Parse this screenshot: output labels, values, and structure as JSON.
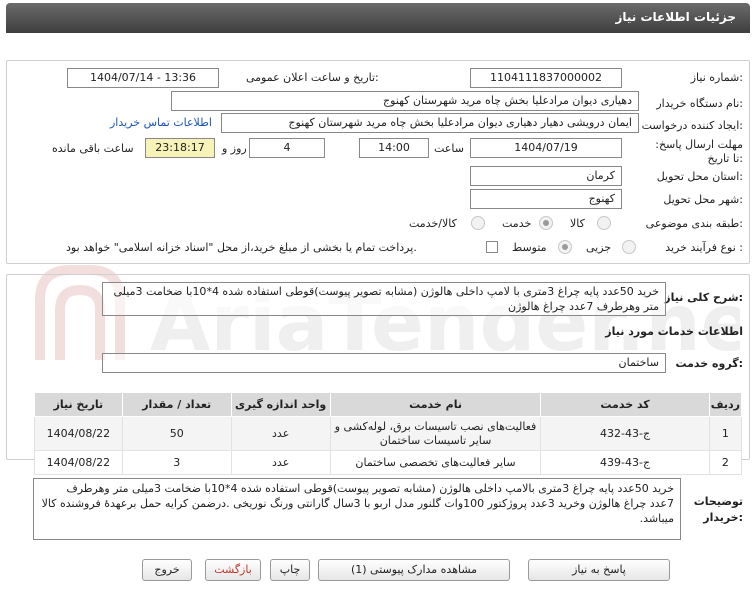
{
  "header": {
    "title": "جزئیات اطلاعات نیاز"
  },
  "need": {
    "number_label": "شماره نیاز:",
    "number_value": "1104111837000002",
    "announce_label": "تاریخ و ساعت اعلان عمومی:",
    "announce_value": "1404/07/14 - 13:36",
    "buyer_org_label": "نام دستگاه خریدار:",
    "buyer_org_value": "دهیاری دیوان مرادعلیا بخش چاه مرید شهرستان کهنوج",
    "creator_label": "ایجاد کننده درخواست:",
    "creator_value": "ایمان درویشی دهیار دهیاری دیوان مرادعلیا بخش چاه مرید شهرستان کهنوج",
    "contact_link": "اطلاعات تماس خریدار",
    "deadline_label": "مهلت ارسال پاسخ: تا تاریخ:",
    "deadline_date": "1404/07/19",
    "time_label": "ساعت",
    "deadline_time": "14:00",
    "days_value": "4",
    "days_label": "روز و",
    "remaining_time": "23:18:17",
    "remaining_label": "ساعت باقی مانده",
    "province_label": "استان محل تحویل:",
    "province_value": "کرمان",
    "city_label": "شهر محل تحویل:",
    "city_value": "کهنوج",
    "category_label": "طبقه بندی موضوعی:",
    "category_options": [
      "کالا",
      "خدمت",
      "کالا/خدمت"
    ],
    "category_selected": "خدمت",
    "process_label": "نوع فرآیند خرید :",
    "process_options": [
      "جزیی",
      "متوسط"
    ],
    "process_selected": "جزیی",
    "payment_note": "پرداخت تمام یا بخشی از مبلغ خرید،از محل \"اسناد خزانه اسلامی\" خواهد بود."
  },
  "summary": {
    "label": "شرح کلی نیاز:",
    "value": "خرید 50عدد پایه چراغ 3متری با لامپ داخلی هالوژن (مشابه تصویر پیوست)قوطی استفاده شده 4*10با ضخامت 3میلی متر وهرطرف 7عدد چراغ هالوژن"
  },
  "services": {
    "section_title": "اطلاعات خدمات مورد نیاز",
    "group_label": "گروه خدمت:",
    "group_value": "ساختمان",
    "columns": [
      "ردیف",
      "کد خدمت",
      "نام خدمت",
      "واحد اندازه گیری",
      "تعداد / مقدار",
      "تاریخ نیاز"
    ],
    "rows": [
      [
        "1",
        "ج-43-432",
        "فعالیت‌های نصب تاسیسات برق، لوله‌کشی و سایر تاسیسات ساختمان",
        "عدد",
        "50",
        "1404/08/22"
      ],
      [
        "2",
        "ج-43-439",
        "سایر فعالیت‌های تخصصی ساختمان",
        "عدد",
        "3",
        "1404/08/22"
      ]
    ]
  },
  "buyer_notes": {
    "label": "توضیحات خریدار:",
    "value": "خرید 50عدد پایه چراغ 3متری بالامپ داخلی هالوژن (مشابه تصویر پیوست)قوطی استفاده شده 4*10با ضخامت 3میلی متر وهرطرف 7عدد چراغ هالوژن وخرید 3عدد پروژکتور 100وات گلنور مدل اربو با 3سال گارانتی ورنگ نوریخی .درضمن کرایه حمل برعهدۀ فروشنده کالا میباشد."
  },
  "buttons": {
    "reply": "پاسخ به نیاز",
    "attachments": "مشاهده مدارک پیوستی (1)",
    "print": "چاپ",
    "back": "بازگشت",
    "exit": "خروج"
  },
  "colors": {
    "header_bg": "#4d4d4d",
    "link": "#1a55b5",
    "countdown_bg": "#f7f3b8",
    "back_button_text": "#c0392b"
  }
}
